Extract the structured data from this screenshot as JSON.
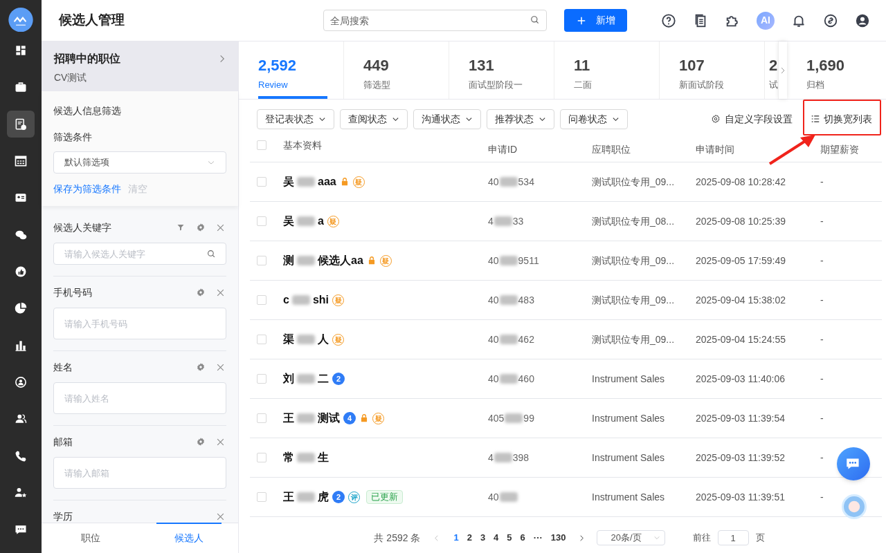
{
  "header": {
    "title": "候选人管理",
    "search": {
      "placeholder": "全局搜索"
    },
    "add_button": {
      "label": "新增"
    },
    "ai_label": "AI"
  },
  "nav": [
    {
      "selected": false
    },
    {
      "selected": false
    },
    {
      "selected": true
    },
    {
      "selected": false
    },
    {
      "selected": false
    },
    {
      "selected": false
    },
    {
      "selected": false
    },
    {
      "selected": false
    },
    {
      "selected": false
    },
    {
      "selected": false
    },
    {
      "selected": false
    },
    {
      "selected": false
    },
    {
      "selected": false
    },
    {
      "selected": false
    }
  ],
  "position_card": {
    "title": "招聘中的职位",
    "subtitle": "CV测试"
  },
  "filter": {
    "heading": "候选人信息筛选",
    "label": "筛选条件",
    "select_value": "默认筛选项",
    "save_link": "保存为筛选条件",
    "clear_link": "清空"
  },
  "fields": [
    {
      "label": "候选人关键字",
      "placeholder": "请输入候选人关键字",
      "kind": "search",
      "has_filter": true,
      "has_settings": true
    },
    {
      "label": "手机号码",
      "placeholder": "请输入手机号码",
      "kind": "text",
      "has_filter": false,
      "has_settings": true
    },
    {
      "label": "姓名",
      "placeholder": "请输入姓名",
      "kind": "text",
      "has_filter": false,
      "has_settings": true
    },
    {
      "label": "邮箱",
      "placeholder": "请输入邮箱",
      "kind": "text",
      "has_filter": false,
      "has_settings": true
    },
    {
      "label": "学历",
      "kind": "cut",
      "has_filter": false,
      "has_settings": false
    }
  ],
  "bottom_tabs": [
    {
      "label": "职位",
      "selected": false
    },
    {
      "label": "候选人",
      "selected": true
    }
  ],
  "stages": [
    {
      "count": "2,592",
      "label": "Review",
      "selected": true
    },
    {
      "count": "449",
      "label": "筛选型",
      "selected": false
    },
    {
      "count": "131",
      "label": "面试型阶段一",
      "selected": false
    },
    {
      "count": "11",
      "label": "二面",
      "selected": false
    },
    {
      "count": "107",
      "label": "新面试阶段",
      "selected": false
    },
    {
      "count": "2",
      "label": "试",
      "selected": false,
      "kind": "cut"
    },
    {
      "count": "1,690",
      "label": "归档",
      "selected": false
    }
  ],
  "status_filters": [
    "登记表状态",
    "查阅状态",
    "沟通状态",
    "推荐状态",
    "问卷状态"
  ],
  "custom_fields_link": "自定义字段设置",
  "wide_list_toggle": "切换宽列表",
  "table": {
    "select_all": {
      "checked": false
    },
    "columns": [
      "基本资料",
      "申请ID",
      "应聘职位",
      "申请时间",
      "期望薪资"
    ],
    "rows": [
      {
        "checked": false,
        "name_start": "吴",
        "name_end": "aaa",
        "marks": [
          {
            "kind": "lock"
          },
          {
            "kind": "circle",
            "text": "疑",
            "color": "#f59a23"
          }
        ],
        "id_start": "40",
        "id_end": "534",
        "job": "测试职位专用_09...",
        "time": "2025-09-08 10:28:42",
        "salary": "-"
      },
      {
        "checked": false,
        "name_start": "吴",
        "name_end": "a",
        "marks": [
          {
            "kind": "circle",
            "text": "疑",
            "color": "#f59a23"
          }
        ],
        "id_start": "4",
        "id_end": "33",
        "job": "测试职位专用_08...",
        "time": "2025-09-08 10:25:39",
        "salary": "-"
      },
      {
        "checked": false,
        "name_start": "测",
        "name_end": "候选人aa",
        "marks": [
          {
            "kind": "lock"
          },
          {
            "kind": "circle",
            "text": "疑",
            "color": "#f59a23"
          }
        ],
        "id_start": "40",
        "id_end": "9511",
        "job": "测试职位专用_09...",
        "time": "2025-09-05 17:59:49",
        "salary": "-"
      },
      {
        "checked": false,
        "name_start": "c",
        "name_end": "shi",
        "marks": [
          {
            "kind": "circle",
            "text": "疑",
            "color": "#f59a23"
          }
        ],
        "id_start": "40",
        "id_end": "483",
        "job": "测试职位专用_09...",
        "time": "2025-09-04 15:38:02",
        "salary": "-"
      },
      {
        "checked": false,
        "name_start": "渠",
        "name_end": "人",
        "marks": [
          {
            "kind": "circle",
            "text": "疑",
            "color": "#f59a23"
          }
        ],
        "id_start": "40",
        "id_end": "462",
        "job": "测试职位专用_09...",
        "time": "2025-09-04 15:24:55",
        "salary": "-"
      },
      {
        "checked": false,
        "name_start": "刘",
        "name_end": "二",
        "marks": [
          {
            "kind": "count",
            "text": "2",
            "color": "#2f7cf6"
          }
        ],
        "id_start": "40",
        "id_end": "460",
        "job": "Instrument Sales",
        "time": "2025-09-03 11:40:06",
        "salary": "-"
      },
      {
        "checked": false,
        "name_start": "王",
        "name_end": "测试",
        "marks": [
          {
            "kind": "count",
            "text": "4",
            "color": "#2f7cf6"
          },
          {
            "kind": "lock"
          },
          {
            "kind": "circle",
            "text": "疑",
            "color": "#f59a23"
          }
        ],
        "id_start": "405",
        "id_end": "99",
        "job": "Instrument Sales",
        "time": "2025-09-03 11:39:54",
        "salary": "-"
      },
      {
        "checked": false,
        "name_start": "常",
        "name_end": "生",
        "marks": [],
        "id_start": "4",
        "id_end": "398",
        "job": "Instrument Sales",
        "time": "2025-09-03 11:39:52",
        "salary": "-"
      },
      {
        "checked": false,
        "name_start": "王",
        "name_end": "虎",
        "marks": [
          {
            "kind": "count",
            "text": "2",
            "color": "#2f7cf6"
          },
          {
            "kind": "circle",
            "text": "评",
            "color": "#17a2c9"
          },
          {
            "kind": "tag",
            "text": "已更新",
            "color": "#2da44e"
          }
        ],
        "id_start": "40",
        "id_end": "",
        "job": "Instrument Sales",
        "time": "2025-09-03 11:39:51",
        "salary": "-"
      }
    ]
  },
  "pagination": {
    "total": "共 2592 条",
    "pages": [
      {
        "label": "1",
        "selected": true
      },
      {
        "label": "2",
        "selected": false
      },
      {
        "label": "3",
        "selected": false
      },
      {
        "label": "4",
        "selected": false
      },
      {
        "label": "5",
        "selected": false
      },
      {
        "label": "6",
        "selected": false
      },
      {
        "label": "···",
        "selected": false
      },
      {
        "label": "130",
        "selected": false
      }
    ],
    "page_size": "20条/页",
    "goto_label": "前往",
    "goto_value": "1",
    "goto_suffix": "页"
  }
}
